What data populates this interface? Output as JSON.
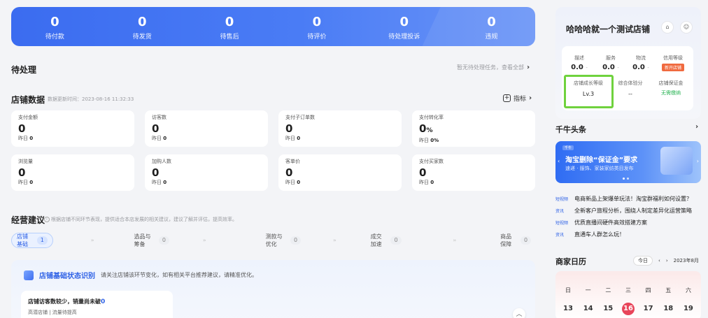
{
  "banner": [
    {
      "value": "0",
      "label": "待付款"
    },
    {
      "value": "0",
      "label": "待发货"
    },
    {
      "value": "0",
      "label": "待售后"
    },
    {
      "value": "0",
      "label": "待评价"
    },
    {
      "value": "0",
      "label": "待处理投诉"
    },
    {
      "value": "0",
      "label": "违规"
    }
  ],
  "pending": {
    "title": "待处理",
    "hint": "暂无待处理任务，查看全部"
  },
  "shop_data": {
    "title": "店铺数据",
    "update_time": "数据更新时间：2023-08-16 11:32:33",
    "metrics_label": "指标",
    "yesterday_prefix": "昨日",
    "cards": [
      {
        "title": "支付金额",
        "value": "0",
        "yesterday": "0"
      },
      {
        "title": "访客数",
        "value": "0",
        "yesterday": "0"
      },
      {
        "title": "支付子订单数",
        "value": "0",
        "yesterday": "0"
      },
      {
        "title": "支付转化率",
        "value": "0",
        "unit": "%",
        "yesterday": "0%"
      },
      {
        "title": "浏览量",
        "value": "0",
        "yesterday": "0"
      },
      {
        "title": "加购人数",
        "value": "0",
        "yesterday": "0"
      },
      {
        "title": "客单价",
        "value": "0",
        "yesterday": "0"
      },
      {
        "title": "支付买家数",
        "value": "0",
        "yesterday": "0"
      }
    ]
  },
  "advice": {
    "title": "经营建议",
    "desc": "根据店铺不同环节表现，提供适合本店发展的相关建议，建议了解并评估，提高效率。",
    "steps": [
      {
        "label": "店铺基础",
        "count": "1"
      },
      {
        "label": "选品与筹备",
        "count": "0"
      },
      {
        "label": "测款与优化",
        "count": "0"
      },
      {
        "label": "成交加速",
        "count": "0"
      },
      {
        "label": "商品保障",
        "count": "0"
      }
    ],
    "panel_title": "店铺基础状态识别",
    "panel_desc": "请关注店铺该环节变化，如有相关平台推荐建议，请精准优化。",
    "card_title": "店铺访客数较少，销量尚未破",
    "card_title_num": "0",
    "card_sub": "高潜店铺 | 流量待提高"
  },
  "shop": {
    "name": "哈哈哈就一个测试店铺",
    "metrics": [
      {
        "label": "描述",
        "value": "0.0",
        "trend": "-"
      },
      {
        "label": "服务",
        "value": "0.0",
        "trend": "-"
      },
      {
        "label": "物流",
        "value": "0.0",
        "trend": "-"
      },
      {
        "label": "信用等级",
        "tag": "新开店铺"
      }
    ],
    "growth_label": "店铺成长等级",
    "growth_value": "Lv.3",
    "score_label": "综合体验分",
    "score_value": "--",
    "deposit_label": "店铺保证金",
    "deposit_value": "无需缴纳"
  },
  "news": {
    "title": "千牛头条",
    "banner_tag": "千牛",
    "banner_title": "淘宝删除“保证金”要求",
    "banner_sub": "速递 · 服饰、家装家纺类目发布",
    "items": [
      {
        "kind": "短视频",
        "text": "电商新品上架爆单玩法！淘宝群福利如何设置？"
      },
      {
        "kind": "资讯",
        "text": "全新客户旅程分析，围绕人制定差异化运营策略"
      },
      {
        "kind": "短视频",
        "text": "优质直播间硬件高效搭建方案"
      },
      {
        "kind": "资讯",
        "text": "直通车人群怎么玩！"
      }
    ]
  },
  "calendar": {
    "title": "商家日历",
    "today_label": "今日",
    "month": "2023年8月",
    "weekdays": [
      "日",
      "一",
      "二",
      "三",
      "四",
      "五",
      "六"
    ],
    "days": [
      "13",
      "14",
      "15",
      "16",
      "17",
      "18",
      "19"
    ],
    "today_index": 3
  },
  "colors": {
    "accent": "#2f62e6",
    "highlight": "#6fd23d",
    "today": "#e8455a"
  }
}
